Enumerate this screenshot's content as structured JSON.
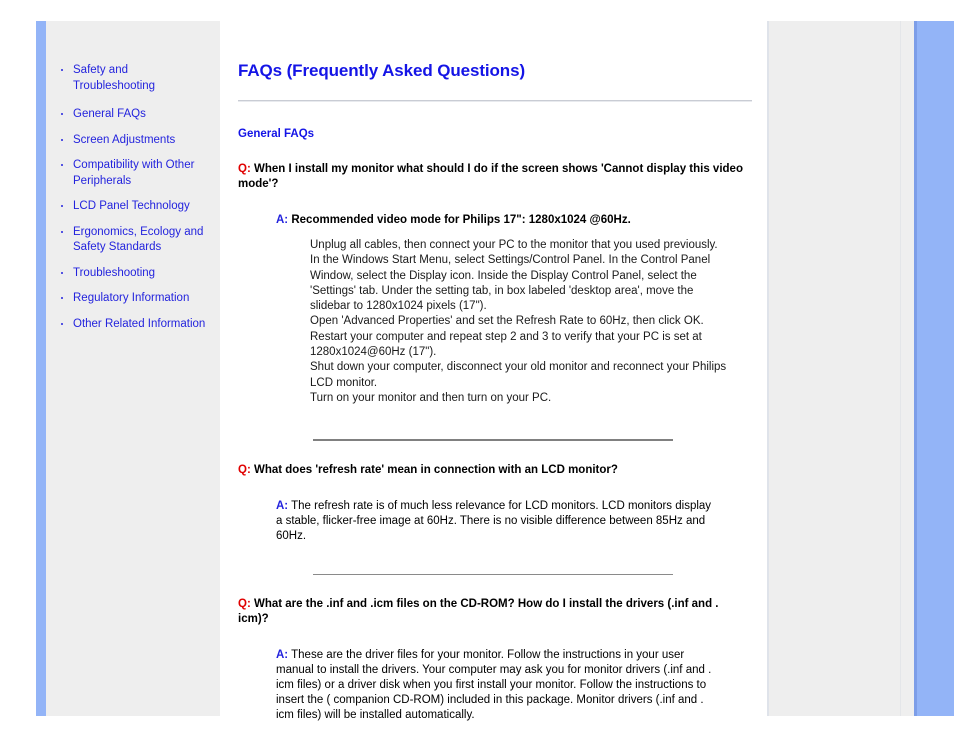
{
  "theme": {
    "link_blue": "#2323dd",
    "heading_blue": "#1414e6",
    "question_red": "#e00000",
    "band_blue": "#93b4f7",
    "panel_gray": "#eeeeee"
  },
  "sidebar": {
    "items": [
      {
        "label": "Safety and Troubleshooting"
      },
      {
        "label": "General FAQs"
      },
      {
        "label": "Screen Adjustments"
      },
      {
        "label": "Compatibility with Other Peripherals"
      },
      {
        "label": "LCD Panel Technology"
      },
      {
        "label": "Ergonomics, Ecology and Safety Standards"
      },
      {
        "label": "Troubleshooting"
      },
      {
        "label": "Regulatory Information"
      },
      {
        "label": "Other Related Information"
      }
    ]
  },
  "main": {
    "title": "FAQs (Frequently Asked Questions)",
    "section_heading": "General FAQs",
    "q_marker": "Q:",
    "a_marker": "A:",
    "faqs": [
      {
        "question": "When I install my monitor what should I do if the screen shows 'Cannot display this video mode'?",
        "answer_lead": "Recommended video mode for Philips 17\": 1280x1024 @60Hz.",
        "steps": [
          "Unplug all cables, then connect your PC to the monitor that you used previously.",
          "In the Windows Start Menu, select Settings/Control Panel. In the Control Panel Window, select the Display icon. Inside the Display Control Panel, select the 'Settings' tab. Under the setting tab, in box labeled 'desktop area', move the slidebar to 1280x1024 pixels (17\").",
          "Open 'Advanced Properties' and set the Refresh Rate to 60Hz, then click OK.",
          "Restart your computer and repeat step 2 and 3 to verify that your PC is set at 1280x1024@60Hz (17\").",
          "Shut down your computer, disconnect your old monitor and reconnect your Philips LCD monitor.",
          "Turn on your monitor and then turn on your PC."
        ]
      },
      {
        "question": "What does 'refresh rate' mean in connection with an LCD monitor?",
        "answer": "The refresh rate is of much less relevance for LCD monitors. LCD monitors display a stable, flicker-free image at 60Hz. There is no visible difference between 85Hz and 60Hz."
      },
      {
        "question": "What are the .inf and .icm files on the CD-ROM? How do I install the drivers (.inf and . icm)?",
        "answer": "These are the driver files for your monitor. Follow the instructions in your user manual to install the drivers. Your computer may ask you for monitor drivers (.inf and . icm files) or a driver disk when you first install your monitor. Follow the instructions to insert the ( companion CD-ROM) included in this package. Monitor drivers (.inf and . icm files) will be installed automatically."
      }
    ]
  }
}
